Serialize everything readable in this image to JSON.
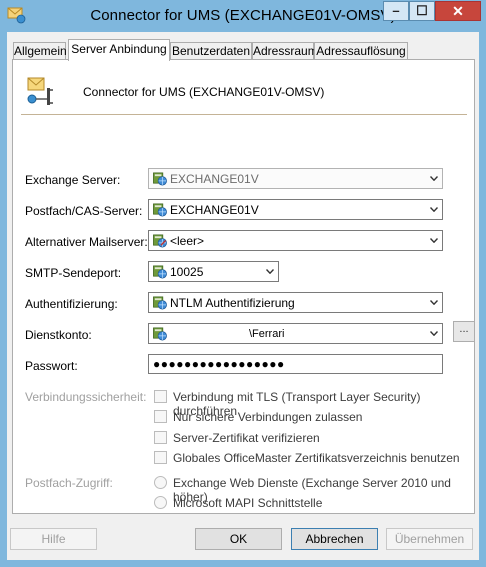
{
  "window": {
    "title": "Connector for UMS (EXCHANGE01V-OMSV)",
    "minimize_glyph": "–",
    "maximize_glyph": "☐",
    "close_glyph": "✕"
  },
  "tabs": [
    {
      "label": "Allgemein",
      "active": false
    },
    {
      "label": "Server Anbindung",
      "active": true
    },
    {
      "label": "Benutzerdaten",
      "active": false
    },
    {
      "label": "Adressraum",
      "active": false
    },
    {
      "label": "Adressauflösung",
      "active": false
    }
  ],
  "header": {
    "icon": "connector-icon",
    "title": "Connector for UMS (EXCHANGE01V-OMSV)"
  },
  "fields": {
    "exchange_server": {
      "label": "Exchange Server:",
      "value": "EXCHANGE01V",
      "icon": "globe-icon"
    },
    "postfach_cas": {
      "label": "Postfach/CAS-Server:",
      "value": "EXCHANGE01V",
      "icon": "globe-icon"
    },
    "alt_mailserver": {
      "label": "Alternativer Mailserver:",
      "value": "<leer>",
      "icon": "globe-edit-icon"
    },
    "smtp_port": {
      "label": "SMTP-Sendeport:",
      "value": "10025",
      "icon": "globe-icon"
    },
    "auth": {
      "label": "Authentifizierung:",
      "value": "NTLM Authentifizierung",
      "icon": "globe-icon"
    },
    "dienstkonto": {
      "label": "Dienstkonto:",
      "value": "\\Ferrari",
      "icon": "globe-icon",
      "browse_label": "..."
    },
    "passwort": {
      "label": "Passwort:",
      "value": "●●●●●●●●●●●●●●●●●"
    }
  },
  "security": {
    "label": "Verbindungssicherheit:",
    "options": [
      "Verbindung mit TLS (Transport Layer Security) durchführen",
      "Nur sichere Verbindungen zulassen",
      "Server-Zertifikat verifizieren",
      "Globales OfficeMaster Zertifikatsverzeichnis benutzen"
    ]
  },
  "mailbox_access": {
    "label": "Postfach-Zugriff:",
    "options": [
      "Exchange Web Dienste (Exchange Server 2010 und höher)",
      "Microsoft MAPI Schnittstelle"
    ]
  },
  "buttons": {
    "help": "Hilfe",
    "ok": "OK",
    "cancel": "Abbrechen",
    "apply": "Übernehmen"
  },
  "colors": {
    "title_bar": "#7fb7dd",
    "close_button": "#c7463c",
    "panel_background": "#ffffff",
    "separator": "#c4b396"
  }
}
